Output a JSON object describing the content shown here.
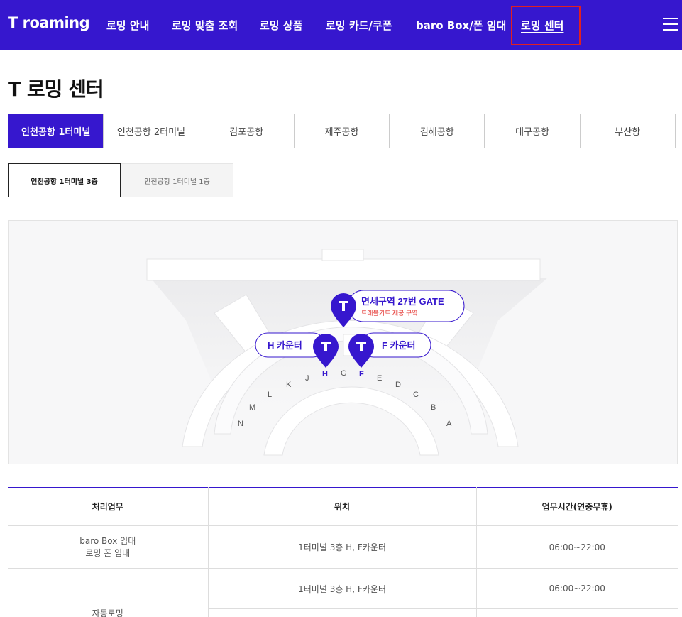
{
  "header": {
    "logo": "T roaming",
    "nav": [
      {
        "label": "로밍 안내"
      },
      {
        "label": "로밍 맞춤 조회"
      },
      {
        "label": "로밍 상품"
      },
      {
        "label": "로밍 카드/쿠폰"
      },
      {
        "label": "baro Box/폰 임대"
      },
      {
        "label": "로밍 센터"
      }
    ],
    "menu_icon": "hamburger-menu-icon"
  },
  "page": {
    "title": "T 로밍 센터"
  },
  "airport_tabs": [
    {
      "label": "인천공항 1터미널",
      "active": true
    },
    {
      "label": "인천공항 2터미널",
      "active": false
    },
    {
      "label": "김포공항",
      "active": false
    },
    {
      "label": "제주공항",
      "active": false
    },
    {
      "label": "김해공항",
      "active": false
    },
    {
      "label": "대구공항",
      "active": false
    },
    {
      "label": "부산항",
      "active": false
    }
  ],
  "floor_tabs": [
    {
      "label": "인천공항 1터미널 3층",
      "active": true
    },
    {
      "label": "인천공항 1터미널 1층",
      "active": false
    }
  ],
  "map": {
    "pin_icon": "t-logo-pin-icon",
    "callouts": {
      "duty_free_title": "면세구역 27번 GATE",
      "duty_free_sub": "트래블키트 제공 구역",
      "h_counter": "H 카운터",
      "f_counter": "F 카운터"
    },
    "counter_letters": [
      "N",
      "M",
      "L",
      "K",
      "J",
      "H",
      "G",
      "F",
      "E",
      "D",
      "C",
      "B",
      "A"
    ],
    "colors": {
      "brand": "#3617ce",
      "accent_red": "#e53935"
    }
  },
  "table": {
    "headers": [
      "처리업무",
      "위치",
      "업무시간(연중무휴)"
    ],
    "rows": [
      {
        "task_line1": "baro Box 임대",
        "task_line2": "로밍 폰 임대",
        "location": "1터미널 3층 H, F카운터",
        "hours": "06:00~22:00"
      },
      {
        "task": "자동로밍",
        "location": "1터미널 3층 H, F카운터",
        "hours": "06:00~22:00"
      }
    ]
  }
}
